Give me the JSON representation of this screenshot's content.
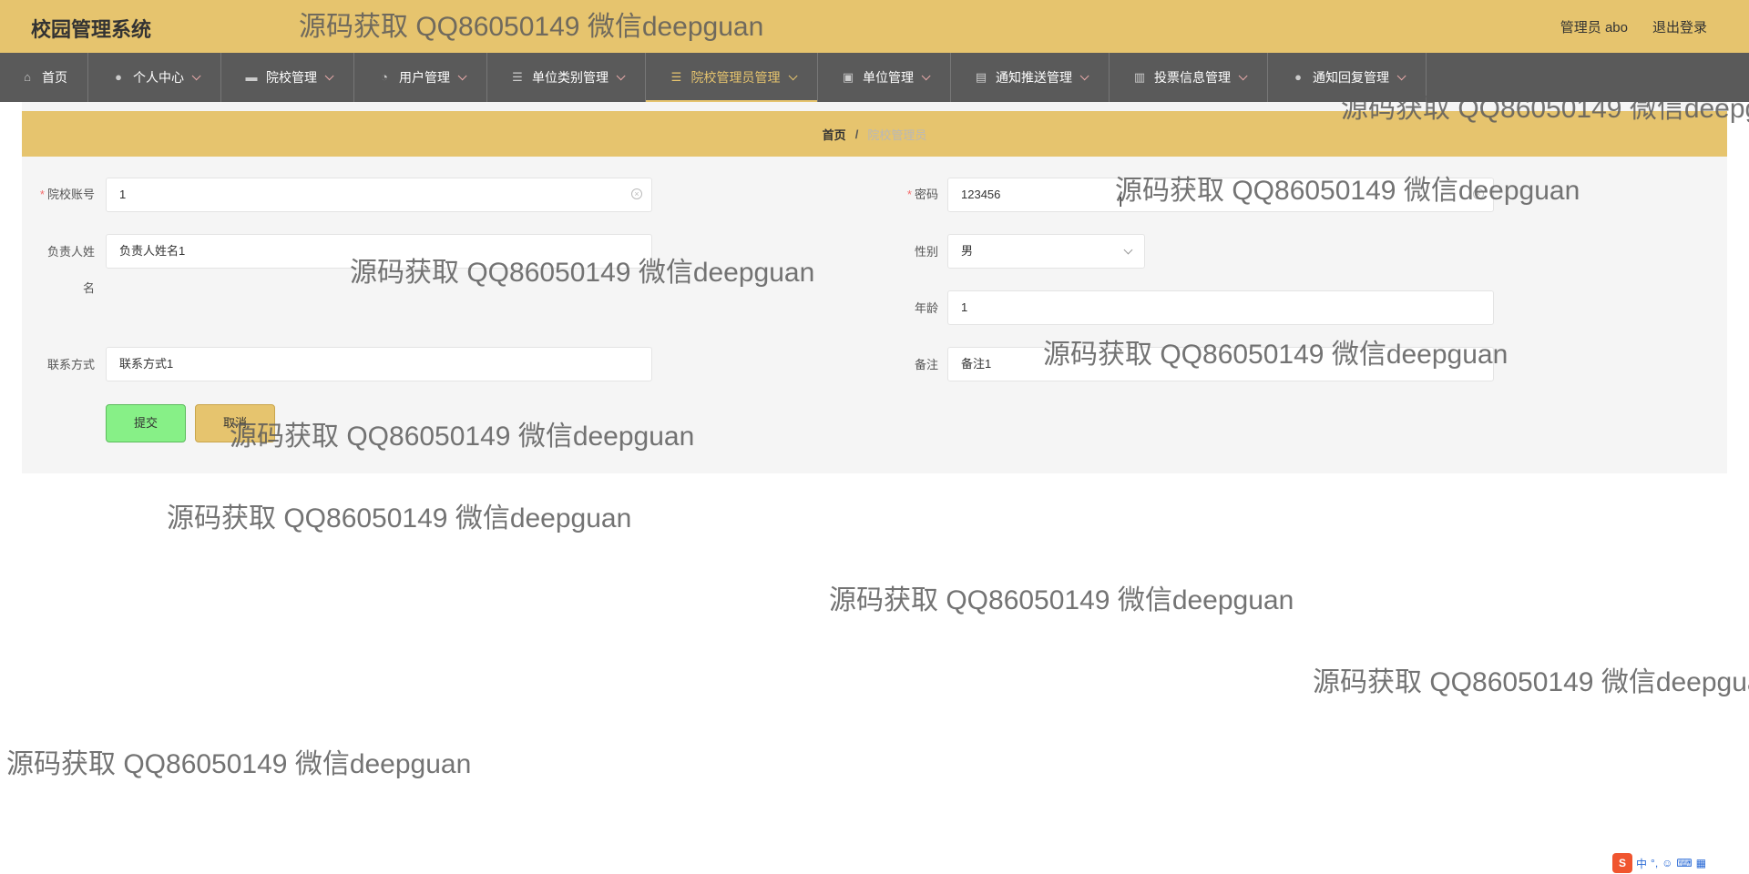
{
  "header": {
    "app_title": "校园管理系统",
    "user_label": "管理员 abo",
    "logout_label": "退出登录"
  },
  "nav": {
    "items": [
      {
        "label": "首页",
        "icon": "home-icon",
        "has_caret": false,
        "active": false
      },
      {
        "label": "个人中心",
        "icon": "user-icon",
        "has_caret": true,
        "active": false
      },
      {
        "label": "院校管理",
        "icon": "ticket-icon",
        "has_caret": true,
        "active": false
      },
      {
        "label": "用户管理",
        "icon": "dashboard-icon",
        "has_caret": true,
        "active": false
      },
      {
        "label": "单位类别管理",
        "icon": "list-icon",
        "has_caret": true,
        "active": false
      },
      {
        "label": "院校管理员管理",
        "icon": "list-icon",
        "has_caret": true,
        "active": true
      },
      {
        "label": "单位管理",
        "icon": "image-icon",
        "has_caret": true,
        "active": false
      },
      {
        "label": "通知推送管理",
        "icon": "briefcase-icon",
        "has_caret": true,
        "active": false
      },
      {
        "label": "投票信息管理",
        "icon": "chart-icon",
        "has_caret": true,
        "active": false
      },
      {
        "label": "通知回复管理",
        "icon": "user-icon",
        "has_caret": true,
        "active": false
      }
    ]
  },
  "breadcrumb": {
    "home": "首页",
    "separator": "/",
    "current": "院校管理员"
  },
  "form": {
    "account": {
      "label": "院校账号",
      "value": "1"
    },
    "password": {
      "label": "密码",
      "value": "123456"
    },
    "manager_name": {
      "label_line1": "负责人姓",
      "label_line2": "名",
      "value": "负责人姓名1"
    },
    "gender": {
      "label": "性别",
      "value": "男"
    },
    "age": {
      "label": "年龄",
      "value": "1"
    },
    "contact": {
      "label": "联系方式",
      "value": "联系方式1"
    },
    "remark": {
      "label": "备注",
      "value": "备注1"
    },
    "submit_label": "提交",
    "cancel_label": "取消"
  },
  "watermark_text": "源码获取 QQ86050149 微信deepguan",
  "ime": {
    "logo": "S",
    "mode": "中"
  }
}
